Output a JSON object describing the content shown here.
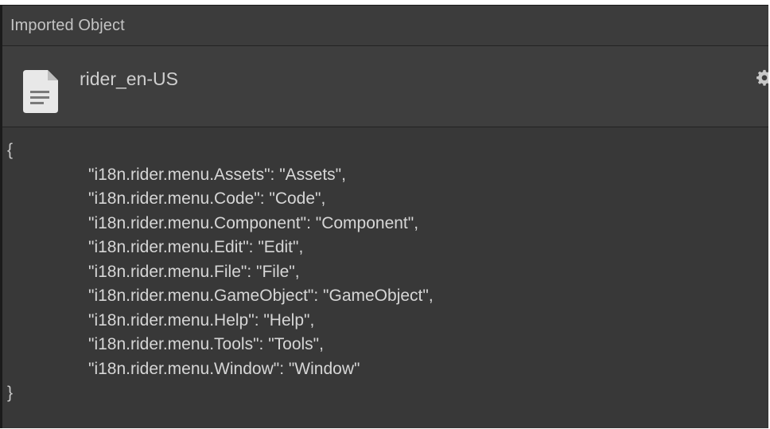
{
  "panel": {
    "title": "Imported Object"
  },
  "asset": {
    "name": "rider_en-US",
    "icon": "document-icon",
    "settings_icon": "gear-icon"
  },
  "json_content": {
    "open_brace": "{",
    "close_brace": "}",
    "entries": [
      "\"i18n.rider.menu.Assets\": \"Assets\",",
      "\"i18n.rider.menu.Code\": \"Code\",",
      "\"i18n.rider.menu.Component\": \"Component\",",
      "\"i18n.rider.menu.Edit\": \"Edit\",",
      "\"i18n.rider.menu.File\": \"File\",",
      "\"i18n.rider.menu.GameObject\": \"GameObject\",",
      "\"i18n.rider.menu.Help\": \"Help\",",
      "\"i18n.rider.menu.Tools\": \"Tools\",",
      "\"i18n.rider.menu.Window\": \"Window\""
    ]
  },
  "colors": {
    "panel_bg": "#383838",
    "header_bg": "#3c3c3c",
    "text": "#d6d6d6"
  }
}
